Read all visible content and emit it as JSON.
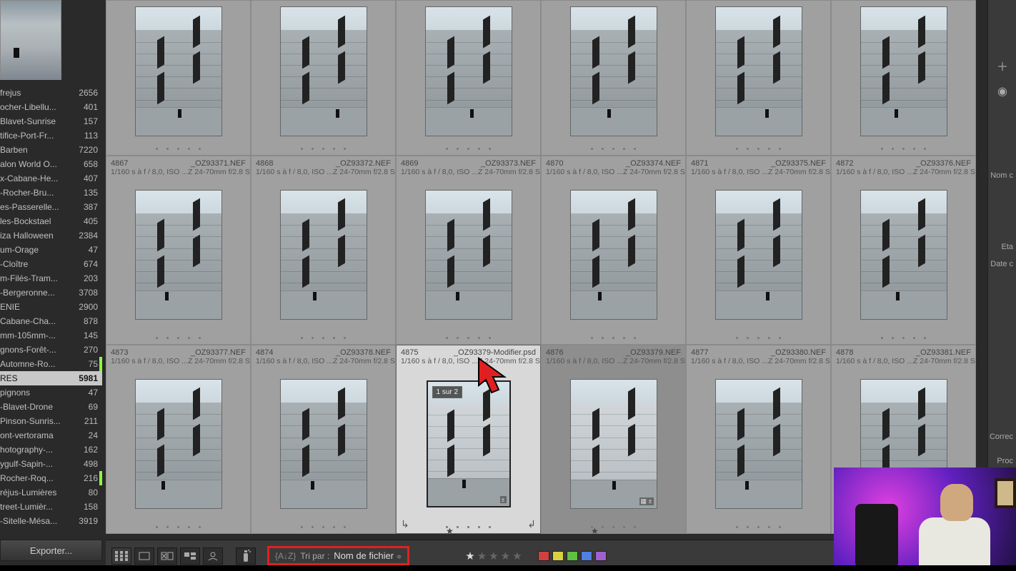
{
  "sidebar": {
    "folders": [
      {
        "name": "frejus",
        "count": 2656,
        "bar": ""
      },
      {
        "name": "ocher-Libellu...",
        "count": 401,
        "bar": ""
      },
      {
        "name": "Blavet-Sunrise",
        "count": 157,
        "bar": ""
      },
      {
        "name": "tifice-Port-Fr...",
        "count": 113,
        "bar": ""
      },
      {
        "name": "Barben",
        "count": 7220,
        "bar": ""
      },
      {
        "name": "alon World O...",
        "count": 658,
        "bar": ""
      },
      {
        "name": "x-Cabane-He...",
        "count": 407,
        "bar": ""
      },
      {
        "name": "-Rocher-Bru...",
        "count": 135,
        "bar": ""
      },
      {
        "name": "es-Passerelle...",
        "count": 387,
        "bar": ""
      },
      {
        "name": "les-Bockstael",
        "count": 405,
        "bar": ""
      },
      {
        "name": "iza Halloween",
        "count": 2384,
        "bar": ""
      },
      {
        "name": "um-Orage",
        "count": 47,
        "bar": ""
      },
      {
        "name": "-Cloître",
        "count": 674,
        "bar": ""
      },
      {
        "name": "m-Filés-Tram...",
        "count": 203,
        "bar": ""
      },
      {
        "name": "-Bergeronne...",
        "count": 3708,
        "bar": ""
      },
      {
        "name": "ENIE",
        "count": 2900,
        "bar": ""
      },
      {
        "name": "Cabane-Cha...",
        "count": 878,
        "bar": ""
      },
      {
        "name": "mm-105mm-...",
        "count": 145,
        "bar": ""
      },
      {
        "name": "gnons-Forêt-...",
        "count": 270,
        "bar": ""
      },
      {
        "name": "Automne-Ro...",
        "count": 75,
        "bar": "#8cff40"
      },
      {
        "name": "RES",
        "count": 5981,
        "selected": true
      },
      {
        "name": "pignons",
        "count": 47,
        "bar": ""
      },
      {
        "name": "-Blavet-Drone",
        "count": 69,
        "bar": ""
      },
      {
        "name": "Pinson-Sunris...",
        "count": 211,
        "bar": ""
      },
      {
        "name": "ont-vertorama",
        "count": 24,
        "bar": ""
      },
      {
        "name": "hotography-...",
        "count": 162,
        "bar": ""
      },
      {
        "name": "ygulf-Sapin-...",
        "count": 498,
        "bar": ""
      },
      {
        "name": "Rocher-Roq...",
        "count": 216,
        "bar": "#8cff40"
      },
      {
        "name": "réjus-Lumières",
        "count": 80,
        "bar": ""
      },
      {
        "name": "treet-Lumièr...",
        "count": 158,
        "bar": ""
      },
      {
        "name": "-Sitelle-Mésa...",
        "count": 3919,
        "bar": ""
      }
    ],
    "export_label": "Exporter..."
  },
  "grid": {
    "meta_line": "1/160 s à f / 8,0, ISO ...Z 24-70mm f/2.8 S)",
    "row1": [
      {
        "idx": "4867",
        "file": "_OZ93371.NEF"
      },
      {
        "idx": "4868",
        "file": "_OZ93372.NEF"
      },
      {
        "idx": "4869",
        "file": "_OZ93373.NEF"
      },
      {
        "idx": "4870",
        "file": "_OZ93374.NEF"
      },
      {
        "idx": "4871",
        "file": "_OZ93375.NEF"
      },
      {
        "idx": "4872",
        "file": "_OZ93376.NEF"
      }
    ],
    "row2": [
      {
        "idx": "4873",
        "file": "_OZ93377.NEF"
      },
      {
        "idx": "4874",
        "file": "_OZ93378.NEF"
      },
      {
        "idx": "4875",
        "file": "_OZ93379-Modifier.psd",
        "selected": true,
        "stack": "1 sur 2",
        "starred": true
      },
      {
        "idx": "4876",
        "file": "_OZ93379.NEF",
        "adjacent": true,
        "starred": true,
        "devbadges": true
      },
      {
        "idx": "4877",
        "file": "_OZ93380.NEF"
      },
      {
        "idx": "4878",
        "file": "_OZ93381.NEF"
      }
    ]
  },
  "toolbar": {
    "sort_label": "Tri par :",
    "sort_value": "Nom de fichier",
    "rating_stars": 1,
    "colors": [
      "#d04040",
      "#d8d040",
      "#60c040",
      "#5080e0",
      "#a060d0"
    ]
  },
  "right_panel": {
    "labels": [
      "Nom c",
      "Eta",
      "Date c",
      "Correc",
      "Proc"
    ]
  }
}
